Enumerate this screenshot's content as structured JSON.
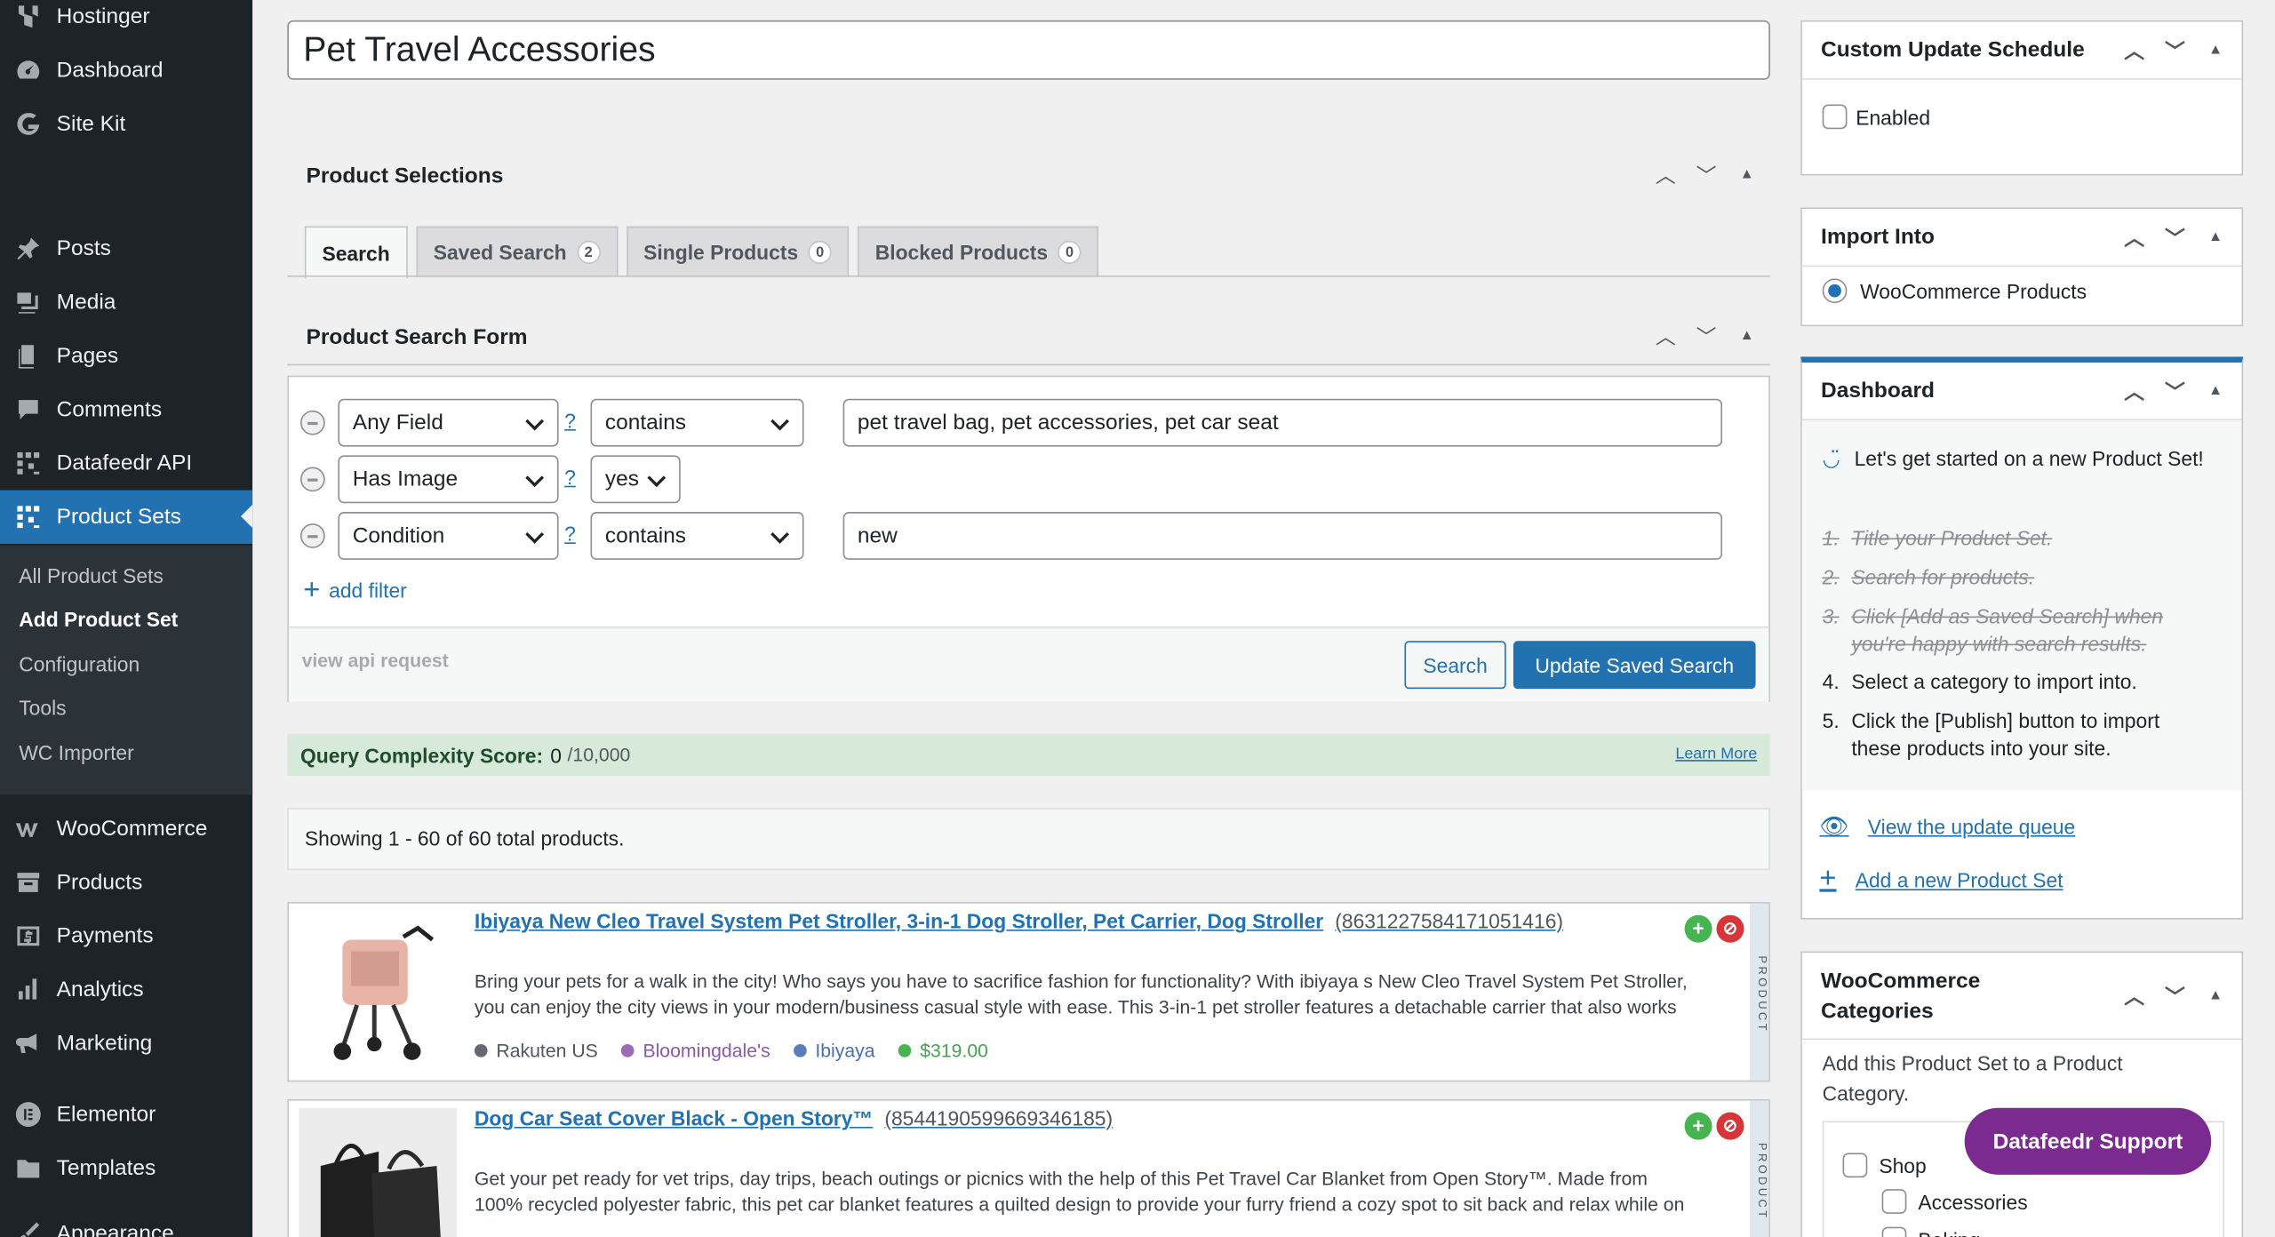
{
  "sidebar": {
    "items": [
      {
        "label": "Hostinger",
        "icon": "hostinger-icon"
      },
      {
        "label": "Dashboard",
        "icon": "dashboard-icon"
      },
      {
        "label": "Site Kit",
        "icon": "google-icon"
      },
      {
        "label": "Posts",
        "icon": "pin-icon"
      },
      {
        "label": "Media",
        "icon": "media-icon"
      },
      {
        "label": "Pages",
        "icon": "pages-icon"
      },
      {
        "label": "Comments",
        "icon": "comment-icon"
      },
      {
        "label": "Datafeedr API",
        "icon": "datafeedr-icon"
      },
      {
        "label": "Product Sets",
        "icon": "datafeedr-icon"
      },
      {
        "label": "WooCommerce",
        "icon": "woocommerce-icon"
      },
      {
        "label": "Products",
        "icon": "archive-icon"
      },
      {
        "label": "Payments",
        "icon": "payments-icon"
      },
      {
        "label": "Analytics",
        "icon": "chart-icon"
      },
      {
        "label": "Marketing",
        "icon": "megaphone-icon"
      },
      {
        "label": "Elementor",
        "icon": "elementor-icon"
      },
      {
        "label": "Templates",
        "icon": "folder-icon"
      },
      {
        "label": "Appearance",
        "icon": "brush-icon"
      }
    ],
    "submenu": [
      "All Product Sets",
      "Add Product Set",
      "Configuration",
      "Tools",
      "WC Importer"
    ]
  },
  "title_value": "Pet Travel Accessories",
  "product_selections": {
    "heading": "Product Selections",
    "tabs": [
      {
        "label": "Search",
        "count": ""
      },
      {
        "label": "Saved Search",
        "count": "2"
      },
      {
        "label": "Single Products",
        "count": "0"
      },
      {
        "label": "Blocked Products",
        "count": "0"
      }
    ]
  },
  "search_form": {
    "heading": "Product Search Form",
    "filters": [
      {
        "field": "Any Field",
        "op": "contains",
        "value": "pet travel bag, pet accessories, pet car seat"
      },
      {
        "field": "Has Image",
        "op": "yes",
        "value": ""
      },
      {
        "field": "Condition",
        "op": "contains",
        "value": "new"
      }
    ],
    "help": "?",
    "add_filter": "add filter",
    "view_api": "view api request",
    "search_button": "Search",
    "update_button": "Update Saved Search"
  },
  "query": {
    "label": "Query Complexity Score:",
    "score": "0",
    "max": "/10,000",
    "learn_more": "Learn More"
  },
  "showing": "Showing 1 - 60 of 60 total products.",
  "products": [
    {
      "title": "Ibiyaya New Cleo Travel System Pet Stroller, 3-in-1 Dog Stroller, Pet Carrier, Dog Stroller",
      "id": "(8631227584171051416)",
      "desc1": "Bring your pets for a walk in the city! Who says you have to sacrifice fashion for functionality? With ibiyaya s New Cleo Travel System Pet Stroller,",
      "desc2": "you can enjoy the city views in your modern/business casual style with ease. This 3-in-1 pet stroller features a detachable carrier that also works",
      "network": "Rakuten US",
      "merchant": "Bloomingdale's",
      "brand": "Ibiyaya",
      "price": "$319.00",
      "side": "PRODUCT"
    },
    {
      "title": "Dog Car Seat Cover Black - Open Story™",
      "id": "(8544190599669346185)",
      "desc1": "Get your pet ready for vet trips, day trips, beach outings or picnics with the help of this Pet Travel Car Blanket from Open Story™. Made from",
      "desc2": "100% recycled polyester fabric, this pet car blanket features a quilted design to provide your furry friend a cozy spot to sit back and relax while on",
      "side": "PRODUCT"
    }
  ],
  "right": {
    "schedule": {
      "heading": "Custom Update Schedule",
      "enabled": "Enabled"
    },
    "import": {
      "heading": "Import Into",
      "option": "WooCommerce Products"
    },
    "dashboard": {
      "heading": "Dashboard",
      "intro": "Let's get started on a new Product Set!",
      "steps": [
        {
          "n": "1.",
          "text": "Title your Product Set."
        },
        {
          "n": "2.",
          "text": "Search for products."
        },
        {
          "n": "3.",
          "text": "Click [Add as Saved Search] when you're happy with search results."
        },
        {
          "n": "4.",
          "text": "Select a category to import into."
        },
        {
          "n": "5.",
          "text": "Click the [Publish] button to import these products into your site."
        }
      ],
      "view_queue": "View the update queue",
      "add_new": "Add a new Product Set"
    },
    "categories": {
      "heading": "WooCommerce Categories",
      "desc": "Add this Product Set to a Product Category.",
      "items": [
        "Shop",
        "Accessories",
        "Baking"
      ]
    }
  },
  "support_button": "Datafeedr Support",
  "colors": {
    "accent": "#2271b1",
    "sidebar": "#1d2327",
    "support": "#7b2b8f",
    "score_bg": "#d7e9d9"
  }
}
